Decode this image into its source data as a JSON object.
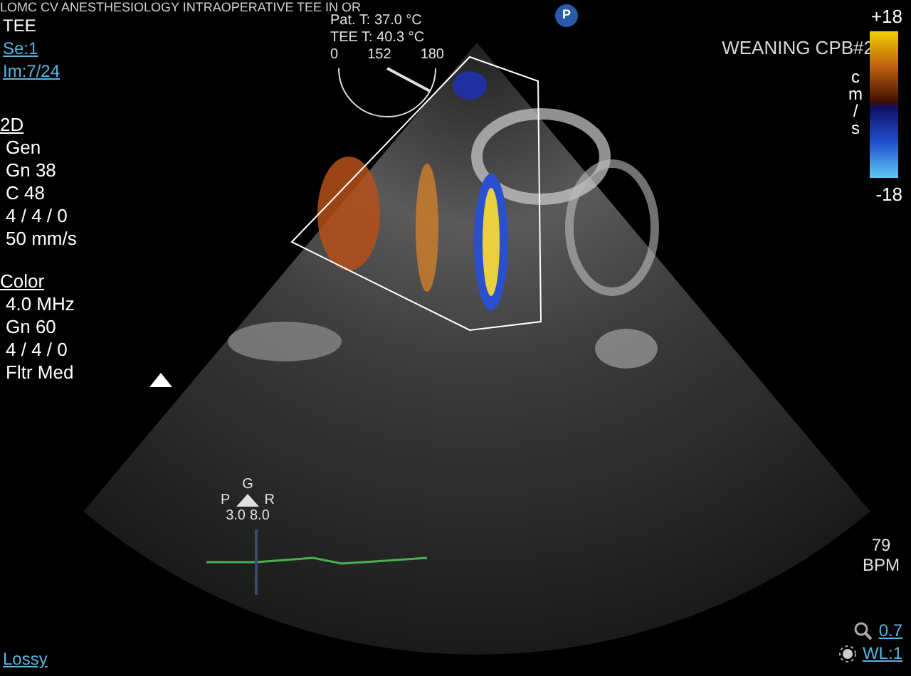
{
  "header": {
    "title": "LOMC CV ANESTHESIOLOGY INTRAOPERATIVE TEE IN OR",
    "modality": "TEE",
    "series_link": "Se:1",
    "image_link": "Im:7/24"
  },
  "temperatures": [
    "Pat. T: 37.0 °C",
    "TEE T: 40.3 °C"
  ],
  "probe_angle": {
    "min": "0",
    "value": "152",
    "max": "180"
  },
  "p_badge": "P",
  "mode_2d": {
    "title": "2D",
    "lines": [
      "Gen",
      "Gn 38",
      "C 48",
      "4 / 4 / 0",
      "50 mm/s"
    ]
  },
  "mode_color": {
    "title": "Color",
    "lines": [
      "4.0 MHz",
      "Gn 60",
      "4 / 4 / 0",
      "Fltr Med"
    ]
  },
  "label": "WEANING CPB#2",
  "color_scale": {
    "max": "+18",
    "min": "-18",
    "unit_letters": [
      "c",
      "m",
      "/",
      "s"
    ]
  },
  "orientation": {
    "top": "G",
    "left": "P",
    "right": "R",
    "left_value": "3.0",
    "right_value": "8.0"
  },
  "heart_rate": {
    "value": "79",
    "unit": "BPM"
  },
  "zoom_link": "0.7",
  "window_level_link": "WL:1",
  "compression_link": "Lossy"
}
